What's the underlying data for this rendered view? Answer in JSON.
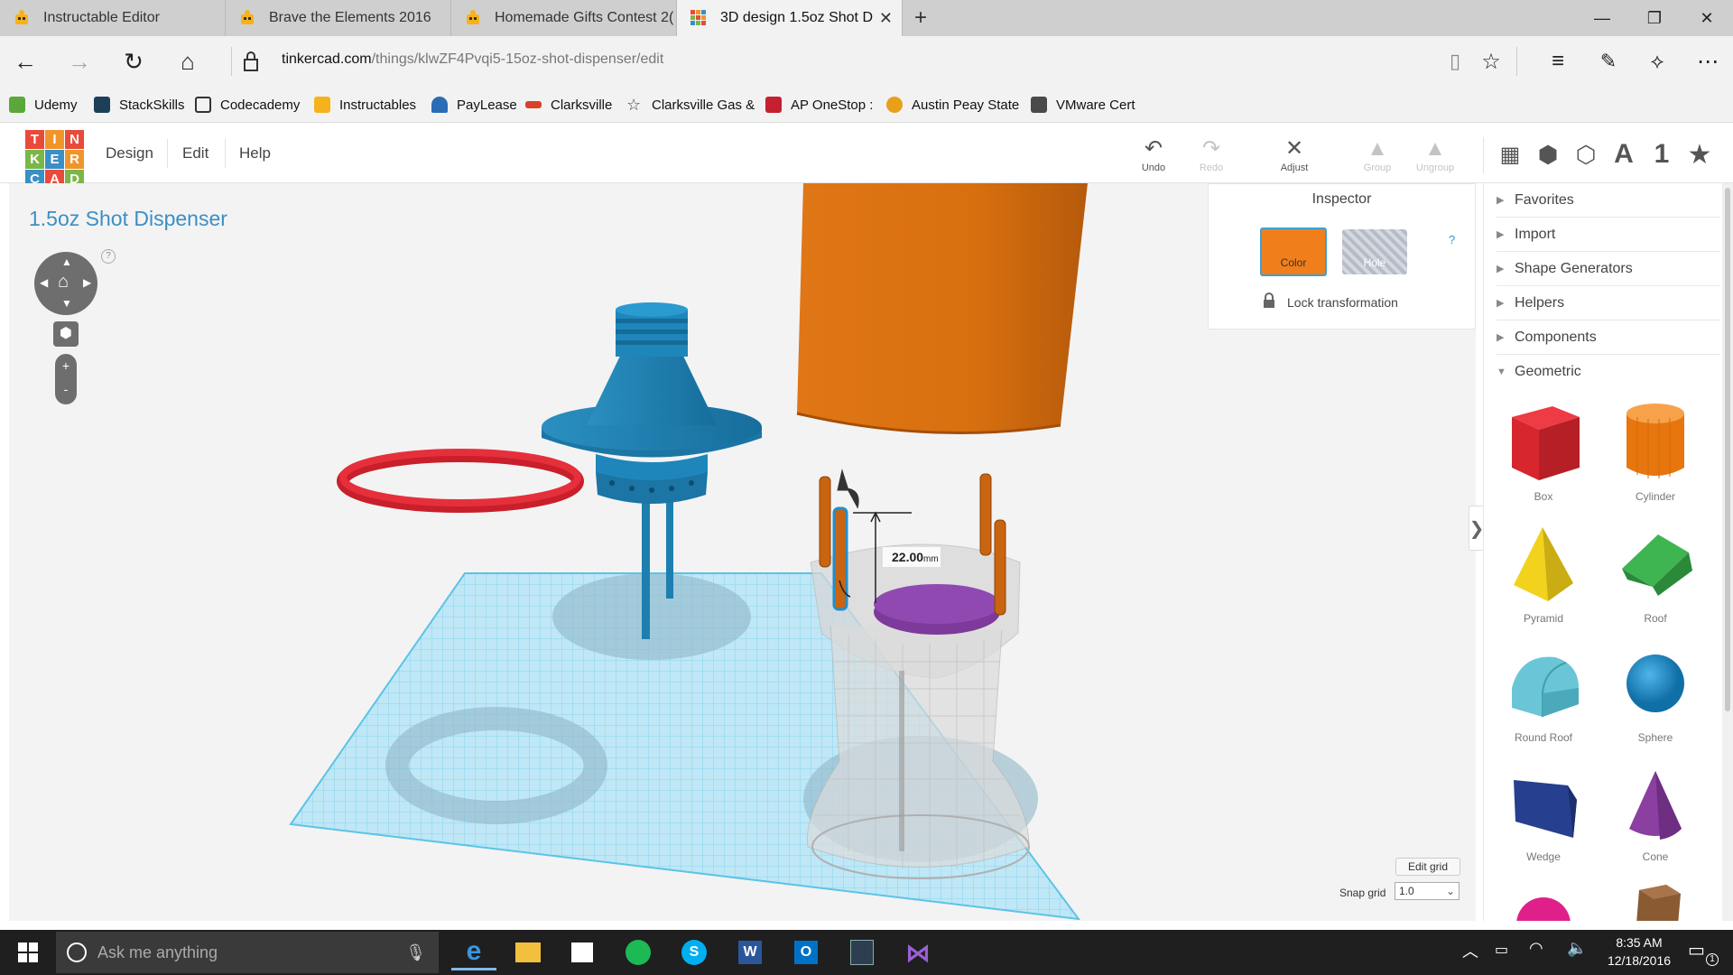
{
  "browser": {
    "tabs": [
      {
        "label": "Instructable Editor"
      },
      {
        "label": "Brave the Elements 2016"
      },
      {
        "label": "Homemade Gifts Contest 2("
      },
      {
        "label": "3D design 1.5oz Shot D"
      }
    ],
    "url_host": "tinkercad.com",
    "url_path": "/things/klwZF4Pvqi5-15oz-shot-dispenser/edit",
    "favorites": [
      {
        "label": "Udemy",
        "color": "#5aa83a"
      },
      {
        "label": "StackSkills",
        "color": "#1c3f57"
      },
      {
        "label": "Codecademy",
        "color": "#ffffff"
      },
      {
        "label": "Instructables",
        "color": "#f6b21b"
      },
      {
        "label": "PayLease",
        "color": "#2a6cb5"
      },
      {
        "label": "Clarksville",
        "color": "#d9412b"
      },
      {
        "label": "Clarksville Gas &",
        "color": "#ffffff"
      },
      {
        "label": "AP OneStop :",
        "color": "#c4202f"
      },
      {
        "label": "Austin Peay State",
        "color": "#e8a01a"
      },
      {
        "label": "VMware Cert",
        "color": "#4a4a4a"
      }
    ]
  },
  "app": {
    "logo": [
      "T",
      "I",
      "N",
      "K",
      "E",
      "R",
      "C",
      "A",
      "D"
    ],
    "menu": [
      {
        "label": "Design"
      },
      {
        "label": "Edit"
      },
      {
        "label": "Help"
      }
    ],
    "tools": [
      {
        "label": "Undo",
        "enabled": true
      },
      {
        "label": "Redo",
        "enabled": false
      },
      {
        "label": "Adjust",
        "enabled": true
      },
      {
        "label": "Group",
        "enabled": false
      },
      {
        "label": "Ungroup",
        "enabled": false
      }
    ],
    "view_tools": [
      {
        "label": "A"
      },
      {
        "label": "1"
      }
    ],
    "design_title": "1.5oz Shot Dispenser",
    "help_mark": "?",
    "zoom_in": "+",
    "zoom_out": "-",
    "dimension_label": "22.00",
    "dimension_unit": "mm",
    "edit_grid_label": "Edit grid",
    "snap_grid_label": "Snap grid",
    "snap_grid_value": "1.0"
  },
  "inspector": {
    "title": "Inspector",
    "color_label": "Color",
    "hole_label": "Hole",
    "help": "?",
    "lock_label": "Lock transformation",
    "color": "#f07f1b"
  },
  "library": {
    "categories": [
      {
        "label": "Favorites",
        "expanded": false
      },
      {
        "label": "Import",
        "expanded": false
      },
      {
        "label": "Shape Generators",
        "expanded": false
      },
      {
        "label": "Helpers",
        "expanded": false
      },
      {
        "label": "Components",
        "expanded": false
      },
      {
        "label": "Geometric",
        "expanded": true
      }
    ],
    "shapes": [
      {
        "label": "Box",
        "color": "#d7262e"
      },
      {
        "label": "Cylinder",
        "color": "#f07f1b"
      },
      {
        "label": "Pyramid",
        "color": "#f2d21d"
      },
      {
        "label": "Roof",
        "color": "#3aa64a"
      },
      {
        "label": "Round Roof",
        "color": "#5bb8c9"
      },
      {
        "label": "Sphere",
        "color": "#1f8fd0"
      },
      {
        "label": "Wedge",
        "color": "#263f8f"
      },
      {
        "label": "Cone",
        "color": "#8b3fa1"
      }
    ]
  },
  "taskbar": {
    "search_placeholder": "Ask me anything",
    "time": "8:35 AM",
    "date": "12/18/2016",
    "notification_count": "1"
  }
}
